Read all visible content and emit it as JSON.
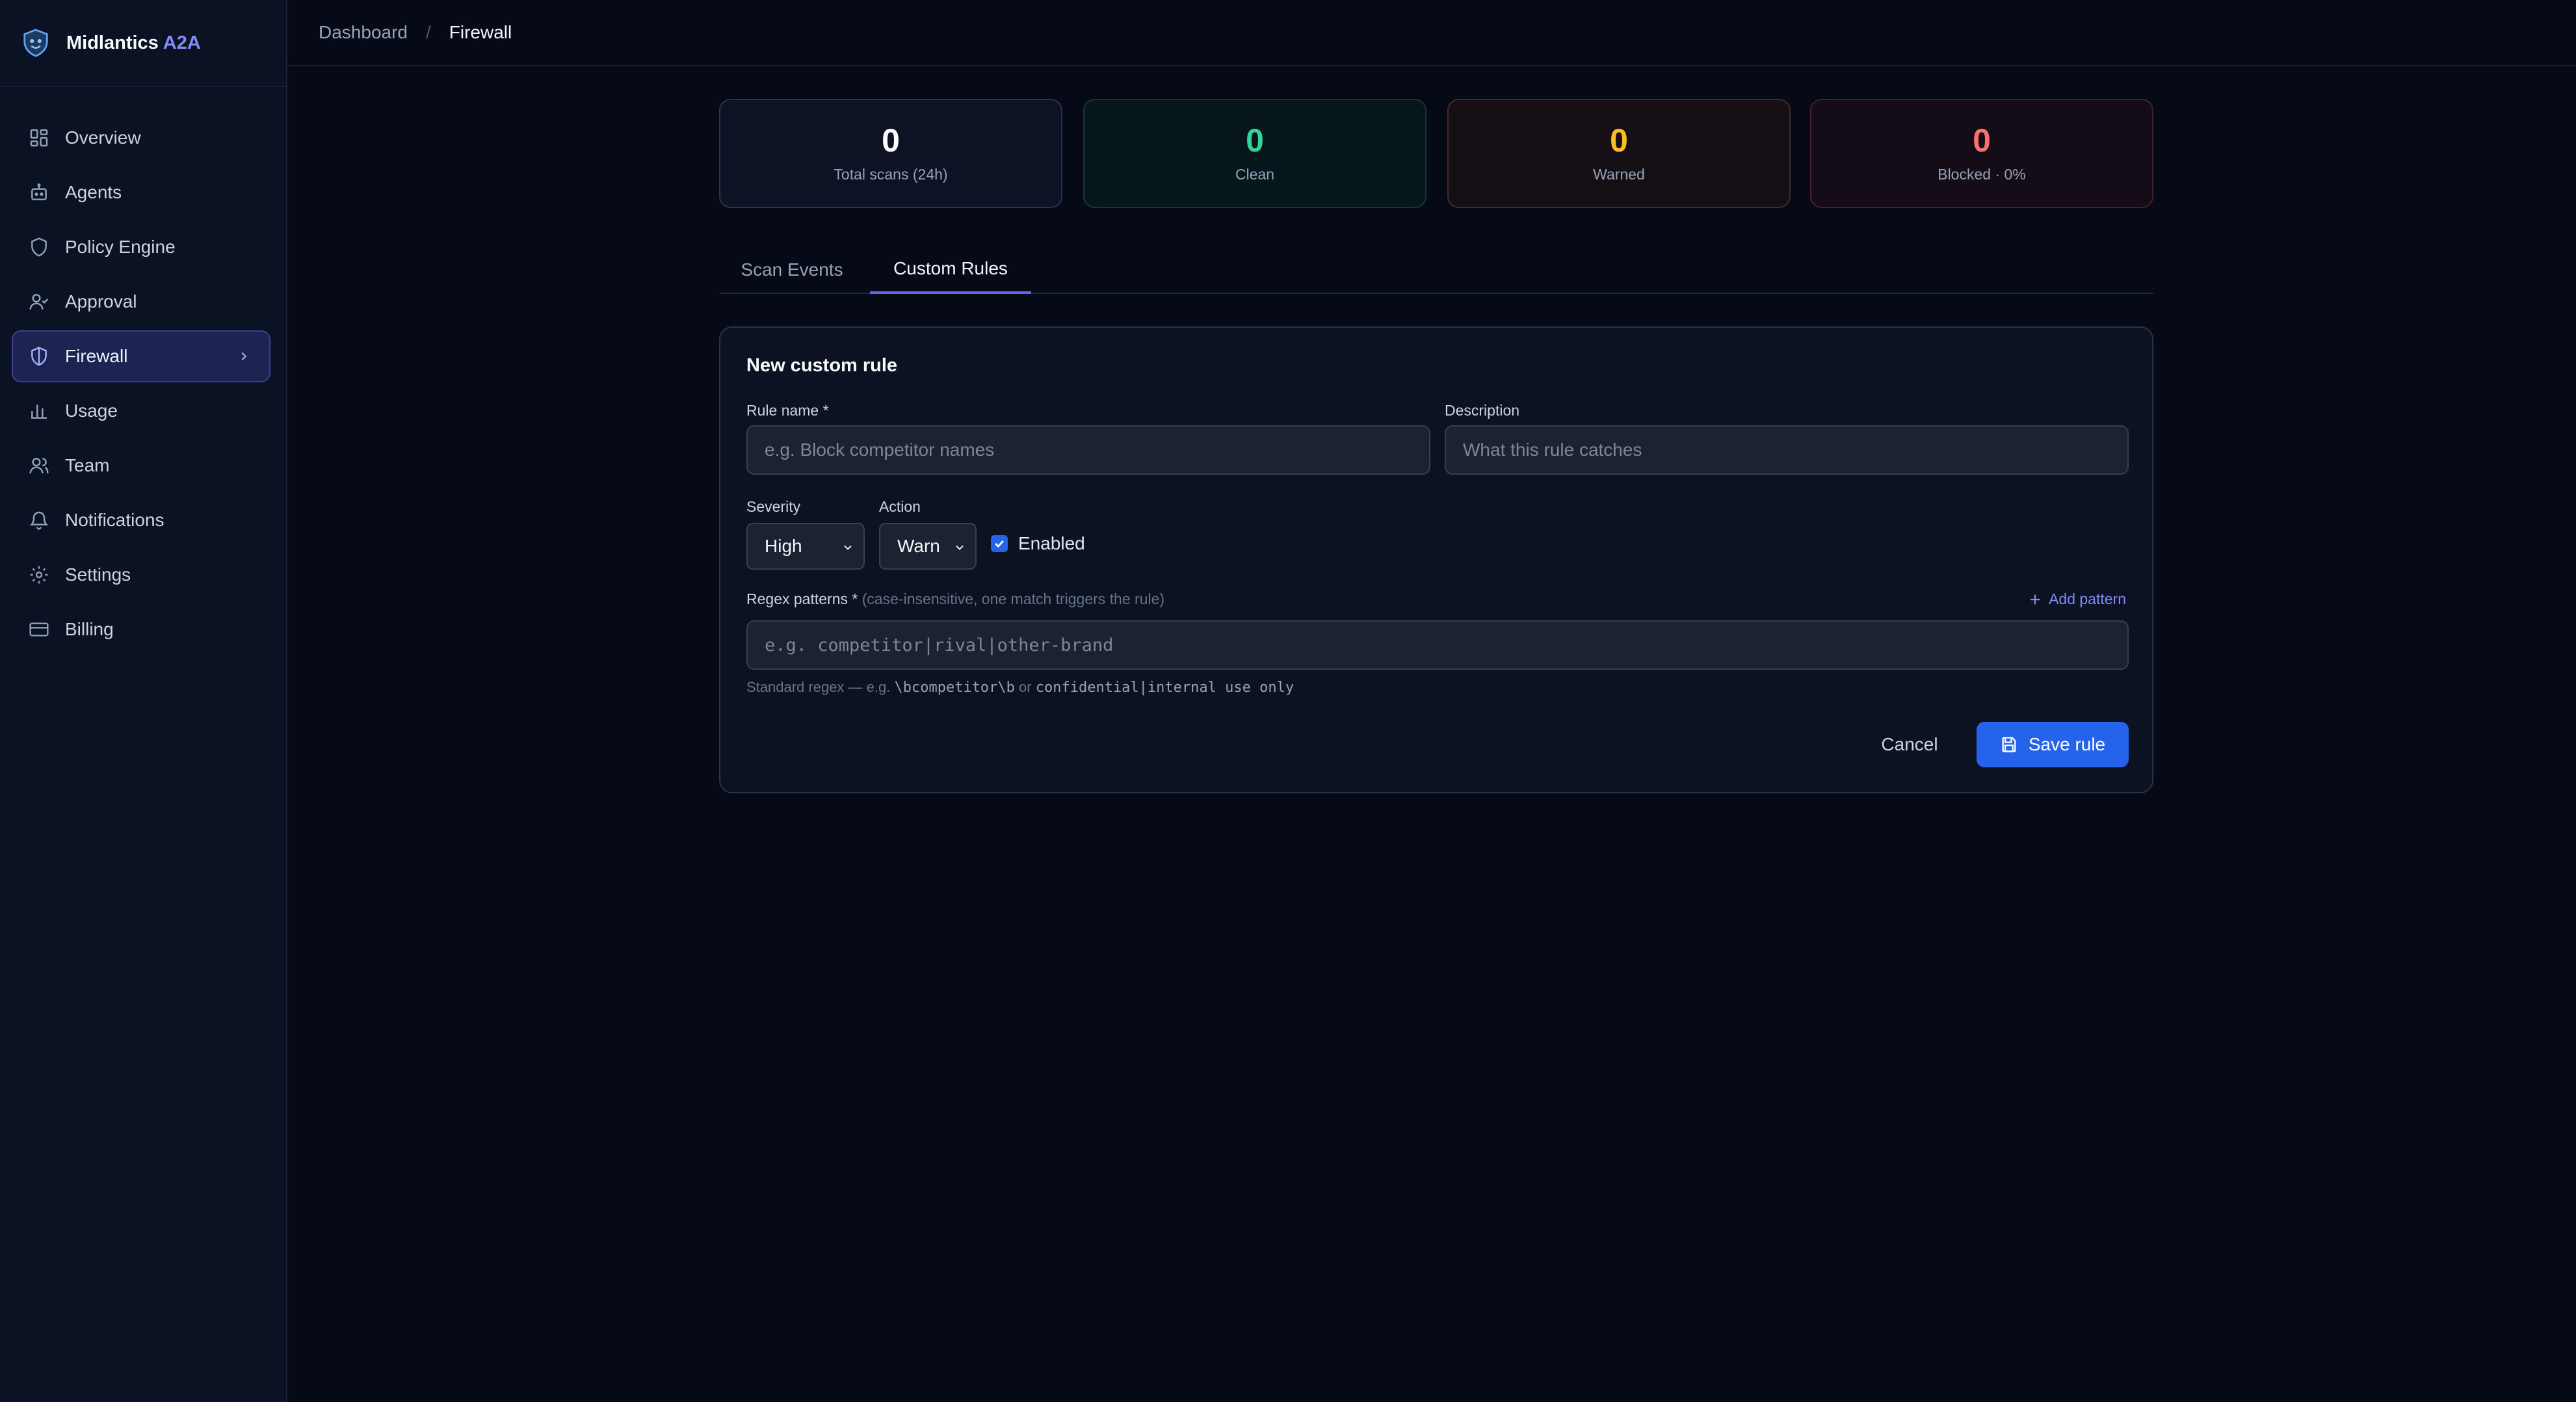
{
  "brand": {
    "name": "Midlantics",
    "accent": "A2A",
    "logo_icon": "shield-face-icon"
  },
  "sidebar": {
    "items": [
      {
        "label": "Overview",
        "icon": "grid-icon",
        "active": false
      },
      {
        "label": "Agents",
        "icon": "robot-icon",
        "active": false
      },
      {
        "label": "Policy Engine",
        "icon": "shield-icon",
        "active": false
      },
      {
        "label": "Approval",
        "icon": "user-check-icon",
        "active": false
      },
      {
        "label": "Firewall",
        "icon": "shield-half-icon",
        "active": true
      },
      {
        "label": "Usage",
        "icon": "bar-chart-icon",
        "active": false
      },
      {
        "label": "Team",
        "icon": "users-icon",
        "active": false
      },
      {
        "label": "Notifications",
        "icon": "bell-icon",
        "active": false
      },
      {
        "label": "Settings",
        "icon": "gear-icon",
        "active": false
      },
      {
        "label": "Billing",
        "icon": "credit-card-icon",
        "active": false
      }
    ]
  },
  "breadcrumb": {
    "parent": "Dashboard",
    "separator": "/",
    "current": "Firewall"
  },
  "stats": {
    "total": {
      "value": "0",
      "label": "Total scans (24h)"
    },
    "clean": {
      "value": "0",
      "label": "Clean"
    },
    "warned": {
      "value": "0",
      "label": "Warned"
    },
    "blocked": {
      "value": "0",
      "label": "Blocked · 0%"
    }
  },
  "tabs": {
    "scan_events": "Scan Events",
    "custom_rules": "Custom Rules",
    "active": "custom_rules"
  },
  "form": {
    "title": "New custom rule",
    "rule_name_label": "Rule name *",
    "rule_name_placeholder": "e.g. Block competitor names",
    "rule_name_value": "",
    "description_label": "Description",
    "description_placeholder": "What this rule catches",
    "description_value": "",
    "severity_label": "Severity",
    "severity_value": "High",
    "action_label": "Action",
    "action_value": "Warn",
    "enabled_label": "Enabled",
    "enabled": true,
    "regex_label": "Regex patterns *",
    "regex_hint": "(case-insensitive, one match triggers the rule)",
    "add_pattern": "Add pattern",
    "regex_placeholder": "e.g. competitor|rival|other-brand",
    "regex_value": "",
    "helper_prefix": "Standard regex — e.g.",
    "helper_example1": "\\bcompetitor\\b",
    "helper_or": "or",
    "helper_example2": "confidential|internal use only",
    "cancel_label": "Cancel",
    "save_label": "Save rule"
  },
  "colors": {
    "accent": "#6366f1",
    "primary": "#2563eb",
    "clean": "#34d399",
    "warned": "#fbbf24",
    "blocked": "#f87171"
  }
}
